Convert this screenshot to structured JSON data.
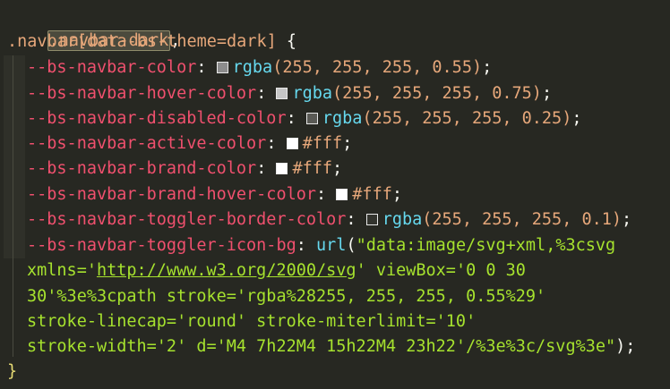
{
  "code": {
    "line1": {
      "selector": ".navbar-dark",
      "comma": ","
    },
    "line2": {
      "sel": ".navbar",
      "attr": "[data-bs-theme=dark]",
      "brace": " {"
    },
    "decls": [
      {
        "prop": "--bs-navbar-color",
        "colon": ": ",
        "fn": "rgba",
        "args": "(255, 255, 255, 0.55)",
        "end": ";",
        "swatch": "#8c8c8c"
      },
      {
        "prop": "--bs-navbar-hover-color",
        "colon": ": ",
        "fn": "rgba",
        "args": "(255, 255, 255, 0.75)",
        "end": ";",
        "swatch": "#c6c6c6"
      },
      {
        "prop": "--bs-navbar-disabled-color",
        "colon": ": ",
        "fn": "rgba",
        "args": "(255, 255, 255, 0.25)",
        "end": ";",
        "swatch": "#5a5a55"
      },
      {
        "prop": "--bs-navbar-active-color",
        "colon": ": ",
        "hex": "#fff",
        "end": ";",
        "swatch": "#ffffff"
      },
      {
        "prop": "--bs-navbar-brand-color",
        "colon": ": ",
        "hex": "#fff",
        "end": ";",
        "swatch": "#ffffff"
      },
      {
        "prop": "--bs-navbar-brand-hover-color",
        "colon": ": ",
        "hex": "#fff",
        "end": ";",
        "swatch": "#ffffff"
      },
      {
        "prop": "--bs-navbar-toggler-border-color",
        "colon": ": ",
        "fn": "rgba",
        "args": "(255, 255, 255, 0.1)",
        "end": ";",
        "swatch": "#33342e"
      }
    ],
    "icon_bg": {
      "prop": "--bs-navbar-toggler-icon-bg",
      "colon": ": ",
      "fn": "url",
      "open": "(",
      "str1": "\"data:image/svg+xml,%3csvg",
      "str2a": "xmlns='",
      "link": "http://www.w3.org/2000/svg",
      "str2b": "' viewBox='0 0 30",
      "str3": "30'%3e%3cpath stroke='rgba%28255, 255, 255, 0.55%29'",
      "str4": "stroke-linecap='round' stroke-miterlimit='10'",
      "str5": "stroke-width='2' d='M4 7h22M4 15h22M4 23h22'/%3e%3c/svg%3e\"",
      "close": ")",
      "end": ";"
    },
    "closing_brace": "}"
  }
}
